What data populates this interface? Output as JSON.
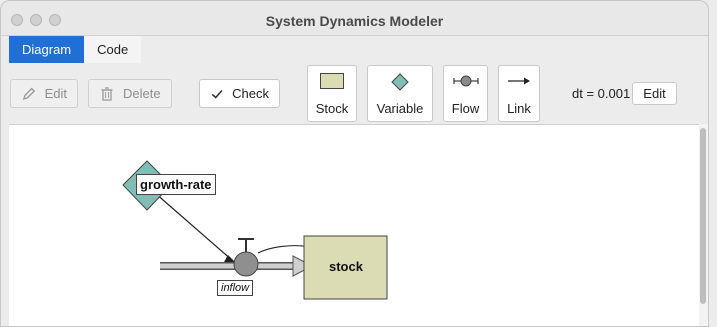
{
  "window": {
    "title": "System Dynamics Modeler"
  },
  "tabs": [
    {
      "label": "Diagram",
      "active": true
    },
    {
      "label": "Code",
      "active": false
    }
  ],
  "toolbar": {
    "edit_label": "Edit",
    "delete_label": "Delete",
    "check_label": "Check",
    "palette": {
      "stock_label": "Stock",
      "variable_label": "Variable",
      "flow_label": "Flow",
      "link_label": "Link"
    },
    "dt_label": "dt = 0.001",
    "dt_edit_label": "Edit"
  },
  "diagram": {
    "variable_label": "growth-rate",
    "flow_label": "inflow",
    "stock_label": "stock"
  },
  "colors": {
    "accent_tab": "#1f6fd6",
    "stock_fill": "#dcdcb4",
    "variable_fill": "#7fbdb5"
  }
}
